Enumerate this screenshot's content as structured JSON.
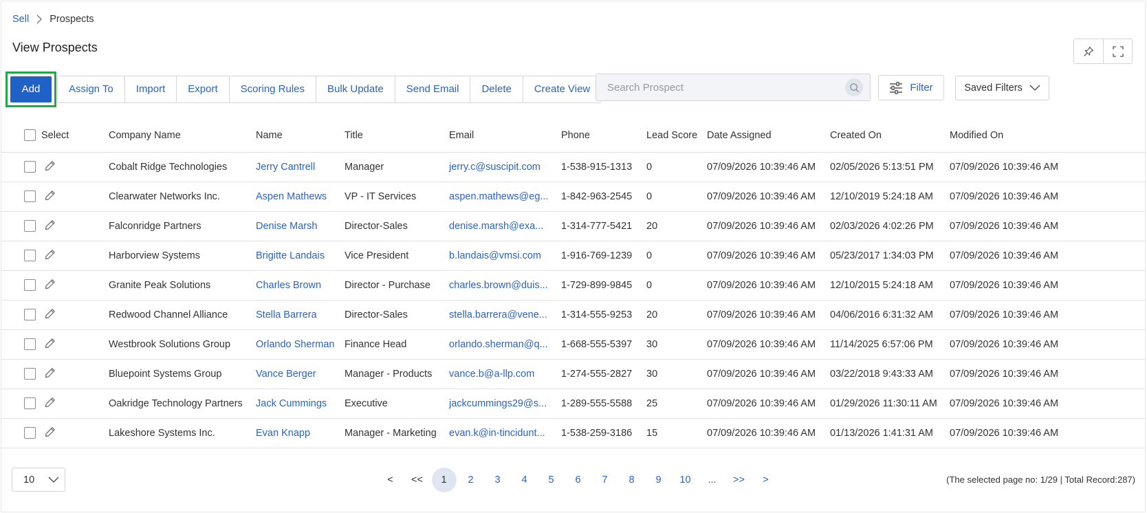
{
  "breadcrumb": {
    "parent": "Sell",
    "current": "Prospects"
  },
  "page": {
    "title": "View Prospects"
  },
  "toolbar": {
    "add_label": "Add",
    "buttons": [
      "Assign To",
      "Import",
      "Export",
      "Scoring Rules",
      "Bulk Update",
      "Send Email",
      "Delete",
      "Create View"
    ]
  },
  "search": {
    "placeholder": "Search Prospect"
  },
  "filter": {
    "label": "Filter"
  },
  "saved_filters": {
    "label": "Saved Filters"
  },
  "table": {
    "select_label": "Select",
    "columns": [
      "Company Name",
      "Name",
      "Title",
      "Email",
      "Phone",
      "Lead Score",
      "Date Assigned",
      "Created On",
      "Modified On"
    ],
    "rows": [
      [
        "Cobalt Ridge Technologies",
        "Jerry Cantrell",
        "Manager",
        "jerry.c@suscipit.com",
        "1-538-915-1313",
        "0",
        "07/09/2026 10:39:46 AM",
        "02/05/2026 5:13:51 PM",
        "07/09/2026 10:39:46 AM"
      ],
      [
        "Clearwater Networks Inc.",
        "Aspen Mathews",
        "VP - IT Services",
        "aspen.mathews@eg...",
        "1-842-963-2545",
        "0",
        "07/09/2026 10:39:46 AM",
        "12/10/2019 5:24:18 AM",
        "07/09/2026 10:39:46 AM"
      ],
      [
        "Falconridge Partners",
        "Denise Marsh",
        "Director-Sales",
        "denise.marsh@exa...",
        "1-314-777-5421",
        "20",
        "07/09/2026 10:39:46 AM",
        "02/03/2026 4:02:26 PM",
        "07/09/2026 10:39:46 AM"
      ],
      [
        "Harborview Systems",
        "Brigitte Landais",
        "Vice President",
        "b.landais@vmsi.com",
        "1-916-769-1239",
        "0",
        "07/09/2026 10:39:46 AM",
        "05/23/2017 1:34:03 PM",
        "07/09/2026 10:39:46 AM"
      ],
      [
        "Granite Peak Solutions",
        "Charles Brown",
        "Director - Purchase",
        "charles.brown@duis...",
        "1-729-899-9845",
        "0",
        "07/09/2026 10:39:46 AM",
        "12/10/2015 5:24:18 AM",
        "07/09/2026 10:39:46 AM"
      ],
      [
        "Redwood Channel Alliance",
        "Stella Barrera",
        "Director-Sales",
        "stella.barrera@vene...",
        "1-314-555-9253",
        "20",
        "07/09/2026 10:39:46 AM",
        "04/06/2016 6:31:32 AM",
        "07/09/2026 10:39:46 AM"
      ],
      [
        "Westbrook Solutions Group",
        "Orlando Sherman",
        "Finance Head",
        "orlando.sherman@q...",
        "1-668-555-5397",
        "30",
        "07/09/2026 10:39:46 AM",
        "11/14/2025 6:57:06 PM",
        "07/09/2026 10:39:46 AM"
      ],
      [
        "Bluepoint Systems Group",
        "Vance Berger",
        "Manager - Products",
        "vance.b@a-llp.com",
        "1-274-555-2827",
        "30",
        "07/09/2026 10:39:46 AM",
        "03/22/2018 9:43:33 AM",
        "07/09/2026 10:39:46 AM"
      ],
      [
        "Oakridge Technology Partners",
        "Jack Cummings",
        "Executive",
        "jackcummings29@s...",
        "1-289-555-5588",
        "25",
        "07/09/2026 10:39:46 AM",
        "01/29/2026 11:30:11 AM",
        "07/09/2026 10:39:46 AM"
      ],
      [
        "Lakeshore Systems Inc.",
        "Evan Knapp",
        "Manager - Marketing",
        "evan.k@in-tincidunt...",
        "1-538-259-3186",
        "15",
        "07/09/2026 10:39:46 AM",
        "01/13/2026 1:41:31 AM",
        "07/09/2026 10:39:46 AM"
      ]
    ]
  },
  "pagination": {
    "page_size": "10",
    "prev": "<",
    "first": "<<",
    "pages": [
      "1",
      "2",
      "3",
      "4",
      "5",
      "6",
      "7",
      "8",
      "9",
      "10",
      "..."
    ],
    "last": ">>",
    "next": ">",
    "current": "1",
    "info": "(The selected page no: 1/29 | Total Record:287)"
  },
  "colors": {
    "primary": "#1f61c7",
    "link": "#2a63c4",
    "highlight": "#1ea84a"
  }
}
